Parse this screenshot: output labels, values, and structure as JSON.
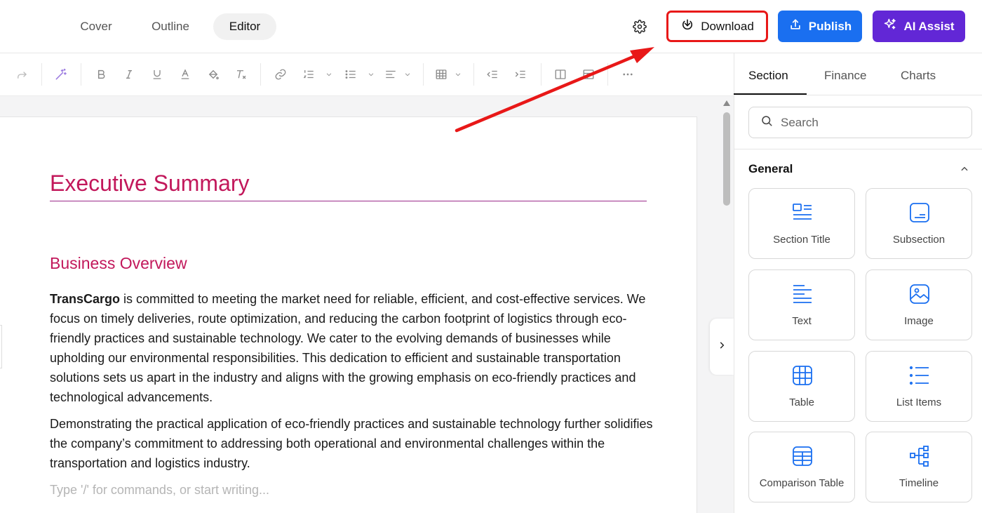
{
  "header": {
    "tabs": [
      {
        "label": "Cover"
      },
      {
        "label": "Outline"
      },
      {
        "label": "Editor"
      }
    ],
    "download_label": "Download",
    "publish_label": "Publish",
    "ai_label": "AI Assist"
  },
  "toolbar": {
    "icons": [
      "redo-icon",
      "magic-wand-icon",
      "bold-icon",
      "italic-icon",
      "underline-icon",
      "text-color-icon",
      "highlight-icon",
      "clear-format-icon",
      "link-icon",
      "ordered-list-icon",
      "bullet-list-icon",
      "align-icon",
      "table-icon",
      "outdent-icon",
      "indent-icon",
      "columns-icon",
      "layout-icon",
      "more-icon"
    ]
  },
  "document": {
    "title": "Executive Summary",
    "heading": "Business Overview",
    "para1_bold": "TransCargo",
    "para1_rest": " is committed to meeting the market need for reliable, efficient, and cost-effective services. We focus on timely deliveries, route optimization, and reducing the carbon footprint of logistics through eco-friendly practices and sustainable technology. We cater to the evolving demands of businesses while upholding our environmental responsibilities. This dedication to efficient and sustainable transportation solutions sets us apart in the industry and aligns with the growing emphasis on eco-friendly practices and technological advancements.",
    "para2": "Demonstrating the practical application of eco-friendly practices and sustainable technology further solidifies the company’s commitment to addressing both operational and environmental challenges within the transportation and logistics industry.",
    "placeholder": "Type '/' for commands, or start writing..."
  },
  "panel": {
    "tabs": [
      {
        "label": "Section"
      },
      {
        "label": "Finance"
      },
      {
        "label": "Charts"
      }
    ],
    "search_placeholder": "Search",
    "group_label": "General",
    "cards": [
      {
        "label": "Section Title",
        "icon": "section-title-icon"
      },
      {
        "label": "Subsection",
        "icon": "subsection-icon"
      },
      {
        "label": "Text",
        "icon": "text-icon"
      },
      {
        "label": "Image",
        "icon": "image-icon"
      },
      {
        "label": "Table",
        "icon": "table-icon"
      },
      {
        "label": "List Items",
        "icon": "list-items-icon"
      },
      {
        "label": "Comparison Table",
        "icon": "comparison-table-icon"
      },
      {
        "label": "Timeline",
        "icon": "timeline-icon"
      }
    ]
  },
  "colors": {
    "accent_title": "#c2185b",
    "publish_blue": "#1a6ff0",
    "ai_purple": "#6227d6",
    "highlight_red": "#e81818",
    "card_icon_blue": "#1a6ff0"
  }
}
